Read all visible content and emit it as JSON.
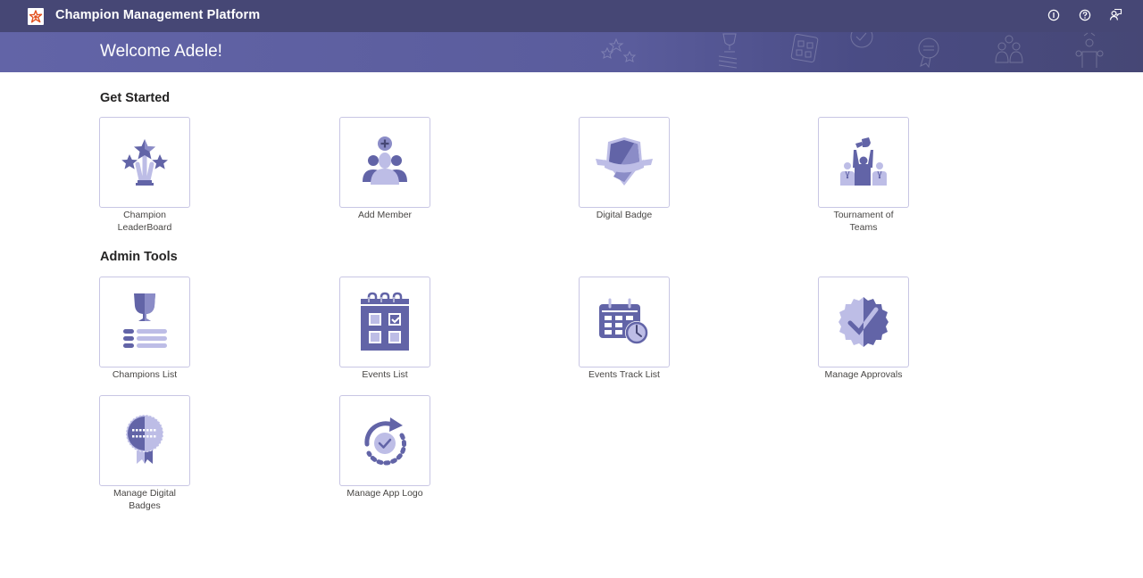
{
  "app": {
    "title": "Champion Management Platform",
    "logo_icon": "star-logo-icon",
    "header_icons": [
      {
        "name": "info-icon",
        "label": "About"
      },
      {
        "name": "help-icon",
        "label": "Help"
      },
      {
        "name": "feedback-icon",
        "label": "Feedback"
      }
    ]
  },
  "banner": {
    "welcome": "Welcome Adele!"
  },
  "sections": {
    "get_started": {
      "title": "Get Started",
      "tiles": [
        {
          "label": "Champion LeaderBoard",
          "icon": "stars-trophy-icon"
        },
        {
          "label": "Add Member",
          "icon": "add-member-icon"
        },
        {
          "label": "Digital Badge",
          "icon": "shield-badge-icon"
        },
        {
          "label": "Tournament of Teams",
          "icon": "tournament-icon"
        }
      ]
    },
    "admin_tools": {
      "title": "Admin Tools",
      "tiles": [
        {
          "label": "Champions List",
          "icon": "trophy-list-icon"
        },
        {
          "label": "Events List",
          "icon": "calendar-icon"
        },
        {
          "label": "Events Track List",
          "icon": "calendar-clock-icon"
        },
        {
          "label": "Manage Approvals",
          "icon": "approval-seal-icon"
        },
        {
          "label": "Manage Digital Badges",
          "icon": "ribbon-badge-icon"
        },
        {
          "label": "Manage App Logo",
          "icon": "refresh-check-icon"
        }
      ]
    }
  },
  "colors": {
    "topbar": "#464775",
    "banner": "#6264a7",
    "icon_dark": "#6264a7",
    "icon_light": "#bdbde6"
  }
}
